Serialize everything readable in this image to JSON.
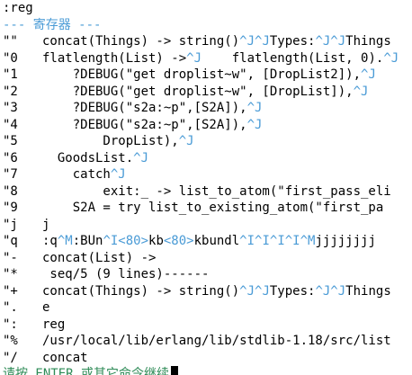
{
  "command": ":reg",
  "header": "--- 寄存器 ---",
  "colors": {
    "special_key": "#4a9bd6",
    "prompt": "#2e8b57",
    "text": "#000000",
    "background": "#ffffff"
  },
  "registers": [
    {
      "name": "\"\"",
      "segs": [
        {
          "t": "concat(Things) -> string()"
        },
        {
          "t": "^J^J",
          "c": true
        },
        {
          "t": "Types:"
        },
        {
          "t": "^J^J",
          "c": true
        },
        {
          "t": "Things"
        }
      ]
    },
    {
      "name": "\"0",
      "segs": [
        {
          "t": "flatlength(List) ->"
        },
        {
          "t": "^J",
          "c": true
        },
        {
          "t": "    flatlength(List, 0)."
        },
        {
          "t": "^J",
          "c": true
        }
      ]
    },
    {
      "name": "\"1",
      "segs": [
        {
          "t": "    ?DEBUG(\"get droplist~w\", [DropList2]),"
        },
        {
          "t": "^J",
          "c": true
        }
      ]
    },
    {
      "name": "\"2",
      "segs": [
        {
          "t": "    ?DEBUG(\"get droplist~w\", [DropList]),"
        },
        {
          "t": "^J",
          "c": true
        }
      ]
    },
    {
      "name": "\"3",
      "segs": [
        {
          "t": "    ?DEBUG(\"s2a:~p\",[S2A]),"
        },
        {
          "t": "^J",
          "c": true
        }
      ]
    },
    {
      "name": "\"4",
      "segs": [
        {
          "t": "    ?DEBUG(\"s2a:~p\",[S2A]),"
        },
        {
          "t": "^J",
          "c": true
        }
      ]
    },
    {
      "name": "\"5",
      "segs": [
        {
          "t": "        DropList),"
        },
        {
          "t": "^J",
          "c": true
        }
      ]
    },
    {
      "name": "\"6",
      "segs": [
        {
          "t": "  GoodsList."
        },
        {
          "t": "^J",
          "c": true
        }
      ]
    },
    {
      "name": "\"7",
      "segs": [
        {
          "t": "    catch"
        },
        {
          "t": "^J",
          "c": true
        }
      ]
    },
    {
      "name": "\"8",
      "segs": [
        {
          "t": "        exit:_ -> list_to_atom(\"first_pass_eli"
        }
      ]
    },
    {
      "name": "\"9",
      "segs": [
        {
          "t": "    S2A = try list_to_existing_atom(\"first_pa"
        }
      ]
    },
    {
      "name": "\"j",
      "segs": [
        {
          "t": "j"
        }
      ]
    },
    {
      "name": "\"q",
      "segs": [
        {
          "t": ":q"
        },
        {
          "t": "^M",
          "c": true
        },
        {
          "t": ":BUn"
        },
        {
          "t": "^I<80>",
          "c": true
        },
        {
          "t": "kb"
        },
        {
          "t": "<80>",
          "c": true
        },
        {
          "t": "kbundl"
        },
        {
          "t": "^I^I^I^I^M",
          "c": true
        },
        {
          "t": "jjjjjjjj"
        }
      ]
    },
    {
      "name": "\"-",
      "segs": [
        {
          "t": "concat(List) ->"
        }
      ]
    },
    {
      "name": "\"*",
      "segs": [
        {
          "t": " seq/5 (9 lines)------"
        }
      ]
    },
    {
      "name": "\"+",
      "segs": [
        {
          "t": "concat(Things) -> string()"
        },
        {
          "t": "^J^J",
          "c": true
        },
        {
          "t": "Types:"
        },
        {
          "t": "^J^J",
          "c": true
        },
        {
          "t": "Things"
        }
      ]
    },
    {
      "name": "\".",
      "segs": [
        {
          "t": "e"
        }
      ]
    },
    {
      "name": "\":",
      "segs": [
        {
          "t": "reg"
        }
      ]
    },
    {
      "name": "\"%",
      "segs": [
        {
          "t": "/usr/local/lib/erlang/lib/stdlib-1.18/src/list"
        }
      ]
    },
    {
      "name": "\"/",
      "segs": [
        {
          "t": "concat"
        }
      ]
    }
  ],
  "prompt": "请按 ENTER 或其它命令继续"
}
